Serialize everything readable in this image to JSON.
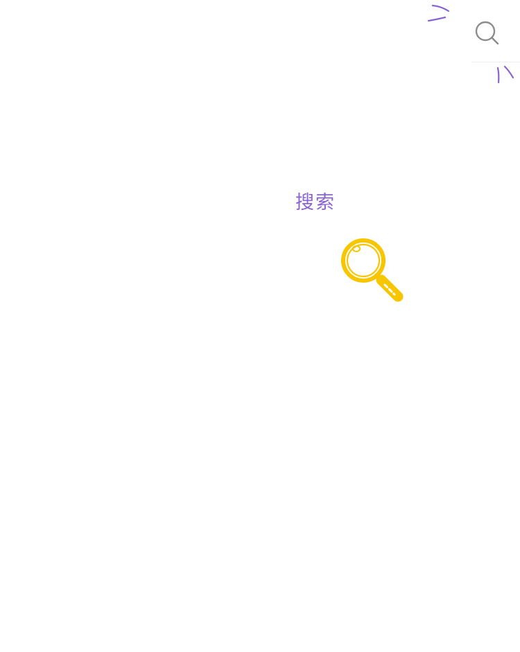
{
  "header": {
    "search_icon": "search-icon"
  },
  "main": {
    "title": "搜索",
    "illustration": "magnifier-illustration"
  },
  "colors": {
    "accent": "#8a63d2",
    "illustration": "#f7c600",
    "icon": "#8c8c8c"
  }
}
